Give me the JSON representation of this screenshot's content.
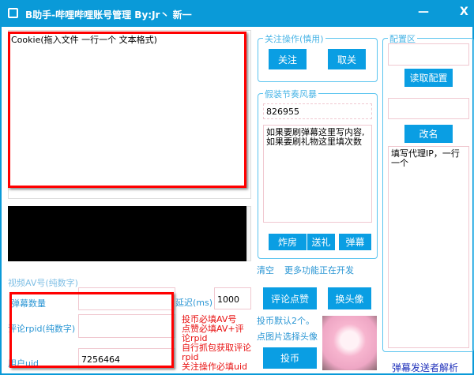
{
  "window": {
    "title": "B助手-哔哩哔哩账号管理 By:Jr丶 新一",
    "minimize": "—",
    "close": "X"
  },
  "cookie": {
    "placeholder": "Cookie(拖入文件 一行一个 文本格式)"
  },
  "follow_group": {
    "title": "关注操作(慎用)",
    "follow": "关注",
    "unfollow": "取关"
  },
  "storm_group": {
    "title": "假装节奏风暴",
    "room_id": "826955",
    "content": "如果要刷弹幕这里写内容,如果要刷礼物这里填次数",
    "bomb": "炸房",
    "gift": "送礼",
    "danmaku": "弹幕"
  },
  "config_group": {
    "title": "配置区",
    "read_config": "读取配置",
    "rename": "改名",
    "proxy_placeholder": "填写代理IP，一行一个"
  },
  "links": {
    "clear": "清空",
    "more": "更多功能正在开发",
    "danmaku_parse": "弹幕发送者解析"
  },
  "form": {
    "av_label": "视频AV号(纯数字)",
    "danmaku_count_label": "弹幕数量",
    "rpid_label": "评论rpid(纯数字)",
    "uid_label": "用户uid",
    "uid_value": "7256464",
    "delay_label": "延迟(ms)",
    "delay_value": "1000"
  },
  "notes": {
    "line1": "投币必填AV号",
    "line2": "点赞必填AV+评论rpid",
    "line3": "自行抓包获取评论rpid",
    "line4": "关注操作必填uid"
  },
  "actions": {
    "like_comment": "评论点赞",
    "change_avatar": "换头像",
    "coin_default": "投币默认2个。",
    "pick_avatar": "点图片选择头像",
    "coin": "投币"
  }
}
